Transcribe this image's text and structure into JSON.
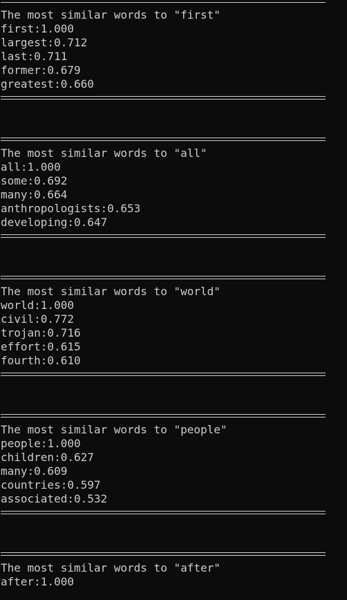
{
  "separator": "==================================================",
  "blocks": [
    {
      "header": "The most similar words to \"first\"",
      "rows": [
        "first:1.000",
        "largest:0.712",
        "last:0.711",
        "former:0.679",
        "greatest:0.660"
      ]
    },
    {
      "header": "The most similar words to \"all\"",
      "rows": [
        "all:1.000",
        "some:0.692",
        "many:0.664",
        "anthropologists:0.653",
        "developing:0.647"
      ]
    },
    {
      "header": "The most similar words to \"world\"",
      "rows": [
        "world:1.000",
        "civil:0.772",
        "trojan:0.716",
        "effort:0.615",
        "fourth:0.610"
      ]
    },
    {
      "header": "The most similar words to \"people\"",
      "rows": [
        "people:1.000",
        "children:0.627",
        "many:0.609",
        "countries:0.597",
        "associated:0.532"
      ]
    },
    {
      "header": "The most similar words to \"after\"",
      "rows": [
        "after:1.000"
      ]
    }
  ]
}
